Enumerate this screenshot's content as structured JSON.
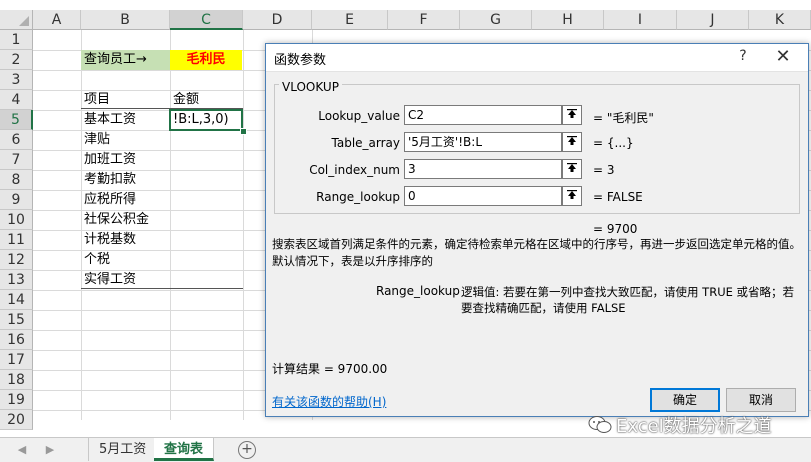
{
  "sheet": {
    "columns": [
      "A",
      "B",
      "C",
      "D",
      "E",
      "F",
      "G",
      "H",
      "I",
      "J",
      "K"
    ],
    "rows": [
      "1",
      "2",
      "3",
      "4",
      "5",
      "6",
      "7",
      "8",
      "9",
      "10",
      "11",
      "12",
      "13",
      "14",
      "15",
      "16",
      "17",
      "18",
      "19",
      "20"
    ],
    "selected_column": "C",
    "selected_row": "5",
    "cells": {
      "b2": "查询员工→",
      "c2": "毛利民",
      "b4": "项目",
      "c4": "金额",
      "items": [
        "基本工资",
        "津贴",
        "加班工资",
        "考勤扣款",
        "应税所得",
        "社保公积金",
        "计税基数",
        "个税",
        "实得工资"
      ],
      "c5_edit": "!B:L,3,0)"
    },
    "colors": {
      "b2_fill": "#c6e0b4",
      "c2_fill": "#ffff00",
      "c2_text": "#ff0000",
      "accent": "#217346"
    }
  },
  "tabs": [
    {
      "label": "5月工资",
      "active": false
    },
    {
      "label": "查询表",
      "active": true
    }
  ],
  "dialog": {
    "title": "函数参数",
    "help_glyph": "?",
    "close_glyph": "✕",
    "function_name": "VLOOKUP",
    "args": [
      {
        "label": "Lookup_value",
        "value": "C2",
        "result": "=  \"毛利民\""
      },
      {
        "label": "Table_array",
        "value": "'5月工资'!B:L",
        "result": "=  {...}"
      },
      {
        "label": "Col_index_num",
        "value": "3",
        "result": "=  3"
      },
      {
        "label": "Range_lookup",
        "value": "0",
        "result": "=  FALSE"
      }
    ],
    "formula_result": "=  9700",
    "description": "搜索表区域首列满足条件的元素，确定待检索单元格在区域中的行序号，再进一步返回选定单元格的值。默认情况下，表是以升序排序的",
    "arg_help_label": "Range_lookup",
    "arg_help_text": "逻辑值: 若要在第一列中查找大致匹配，请使用 TRUE 或省略；若要查找精确匹配，请使用 FALSE",
    "calc_result": "计算结果 =   9700.00",
    "help_link": "有关该函数的帮助(H)",
    "ok_label": "确定",
    "cancel_label": "取消"
  },
  "watermark": "Excel数据分析之道"
}
